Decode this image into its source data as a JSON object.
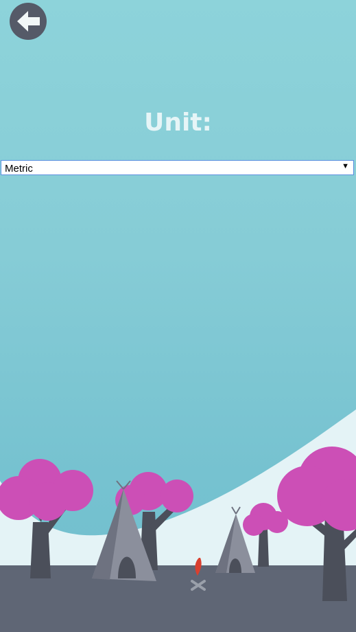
{
  "header": {
    "back_icon": "arrow-left-icon"
  },
  "settings": {
    "title": "Unit:",
    "unit_select": {
      "selected": "Metric",
      "arrow": "▼"
    }
  },
  "colors": {
    "sky_top": "#8dd3da",
    "sky_bottom": "#6fbecd",
    "hill": "#e4f3f6",
    "ground": "#5f6675",
    "tree_foliage": "#cc4fb6",
    "trunk": "#4b4f5a",
    "tent": "#8b8f9c",
    "fire": "#d9402f"
  }
}
